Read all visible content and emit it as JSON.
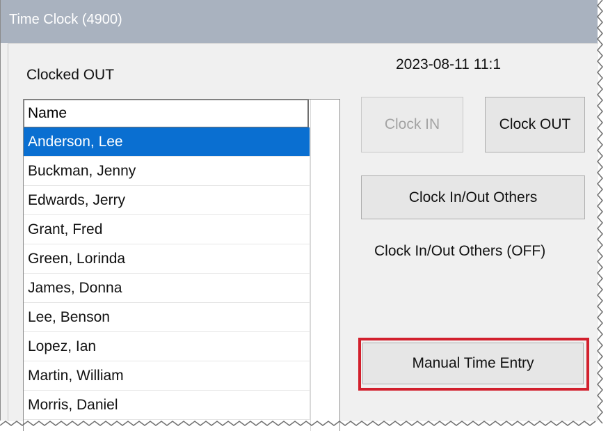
{
  "window": {
    "title": "Time Clock (4900)"
  },
  "status_label": "Clocked OUT",
  "datetime": "2023-08-11 11:1",
  "employee_list": {
    "header": "Name",
    "rows": [
      "Anderson, Lee",
      "Buckman, Jenny",
      "Edwards, Jerry",
      "Grant, Fred",
      "Green, Lorinda",
      "James, Donna",
      "Lee, Benson",
      "Lopez, Ian",
      "Martin, William",
      "Morris, Daniel"
    ],
    "selected_row": "Anderson, Lee"
  },
  "buttons": {
    "clock_in": "Clock IN",
    "clock_out": "Clock OUT",
    "clock_in_out_others": "Clock In/Out Others",
    "manual_time_entry": "Manual Time Entry"
  },
  "others_status": "Clock In/Out Others (OFF)",
  "colors": {
    "title_bar": "#a9b2bf",
    "selection": "#0a6fd1",
    "highlight": "#d2202d"
  }
}
